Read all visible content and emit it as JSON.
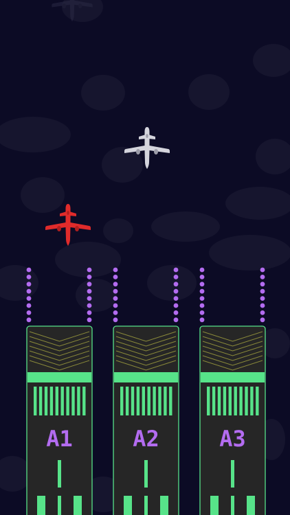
{
  "colors": {
    "background": "#0c0b25",
    "cloud": "#17162f",
    "runway_surface": "#262626",
    "runway_accent": "#57e389",
    "approach_lights": "#b36cf0",
    "runway_label": "#b36cf0",
    "player_plane": "#e02b2b",
    "traffic_plane": "#d4d4dc"
  },
  "runways": [
    {
      "label": "A1"
    },
    {
      "label": "A2"
    },
    {
      "label": "A3"
    }
  ],
  "planes": [
    {
      "name": "player-plane",
      "color": "red",
      "icon": "airplane-icon"
    },
    {
      "name": "traffic-plane",
      "color": "white",
      "icon": "airplane-icon"
    },
    {
      "name": "incoming-plane-shadow",
      "color": "dark",
      "icon": "airplane-icon"
    }
  ]
}
